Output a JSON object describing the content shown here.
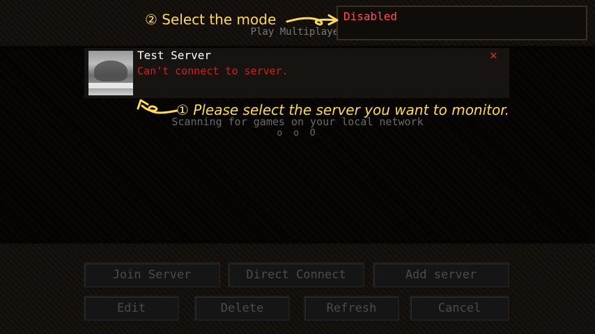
{
  "screen": {
    "title": "Play Multiplayer"
  },
  "mode_selector": {
    "value": "Disabled",
    "value_color": "#ff5050"
  },
  "server_list": {
    "entries": [
      {
        "name": "Test Server",
        "status": "Can't connect to server.",
        "status_color": "#d02020",
        "ping_icon": "no-connection-icon"
      }
    ]
  },
  "lan_scan": {
    "text": "Scanning for games on your local network",
    "indicator": "o o O"
  },
  "annotations": {
    "step2": "② Select the mode",
    "step1": "① Please select the server you want to monitor.",
    "color": "#ffd95a"
  },
  "buttons": {
    "join": "Join Server",
    "direct": "Direct Connect",
    "add": "Add server",
    "edit": "Edit",
    "delete": "Delete",
    "refresh": "Refresh",
    "cancel": "Cancel"
  }
}
